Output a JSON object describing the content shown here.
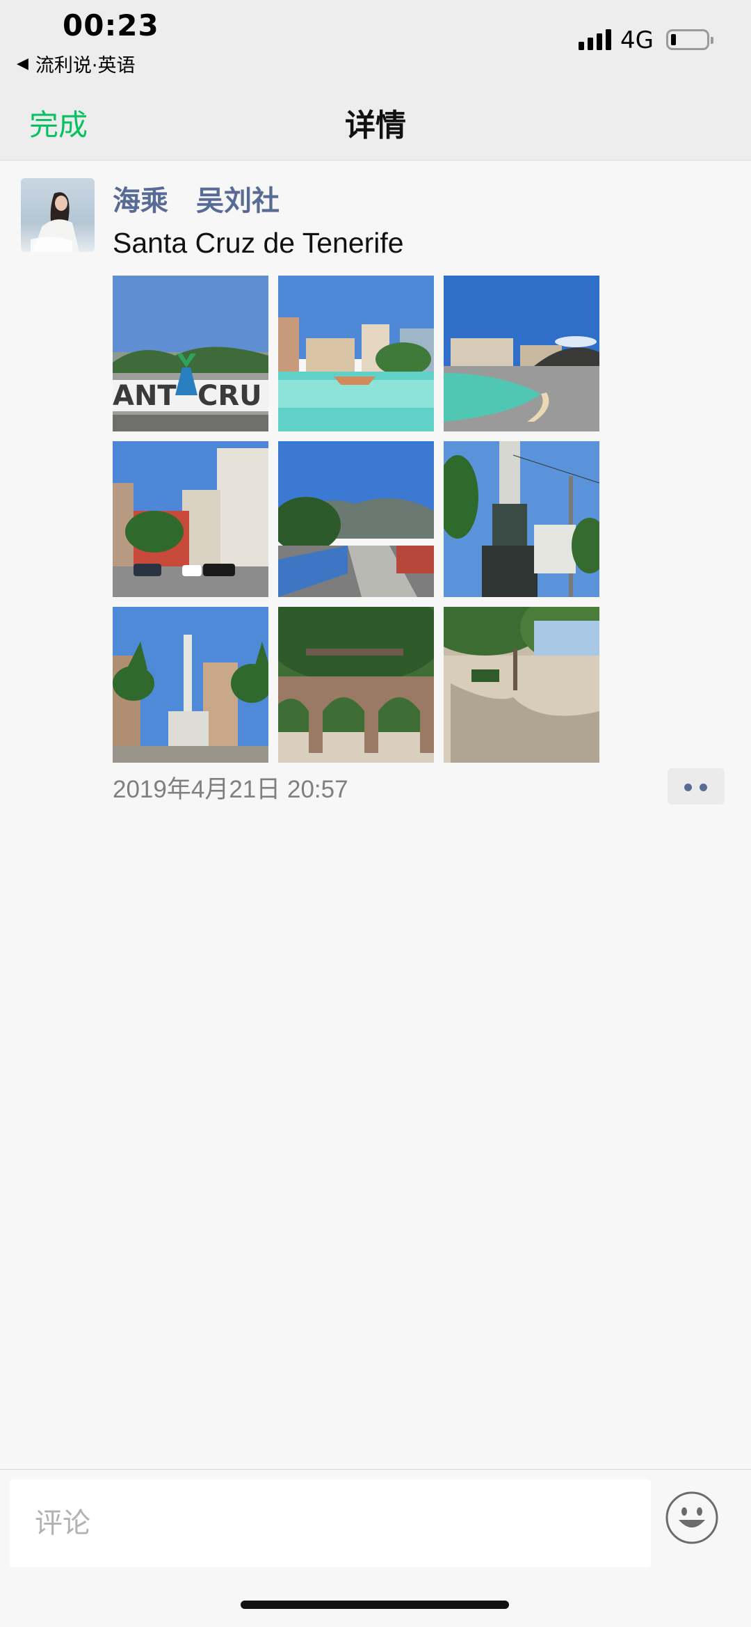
{
  "status_bar": {
    "time": "00:23",
    "back_app": "流利说·英语",
    "network": "4G",
    "battery_level": 0.15
  },
  "nav": {
    "done_label": "完成",
    "title": "详情"
  },
  "post": {
    "author": "海乘　吴刘社",
    "text": "Santa Cruz de Tenerife",
    "timestamp": "2019年4月21日 20:57",
    "photo_count": 9
  },
  "comment_bar": {
    "placeholder": "评论"
  },
  "colors": {
    "accent_green": "#07c160",
    "link_blue": "#576b95",
    "nav_bg": "#ededed",
    "page_bg": "#f7f7f7"
  },
  "icons": [
    "back-triangle-icon",
    "signal-icon",
    "battery-icon",
    "more-dots-icon",
    "emoji-icon"
  ]
}
